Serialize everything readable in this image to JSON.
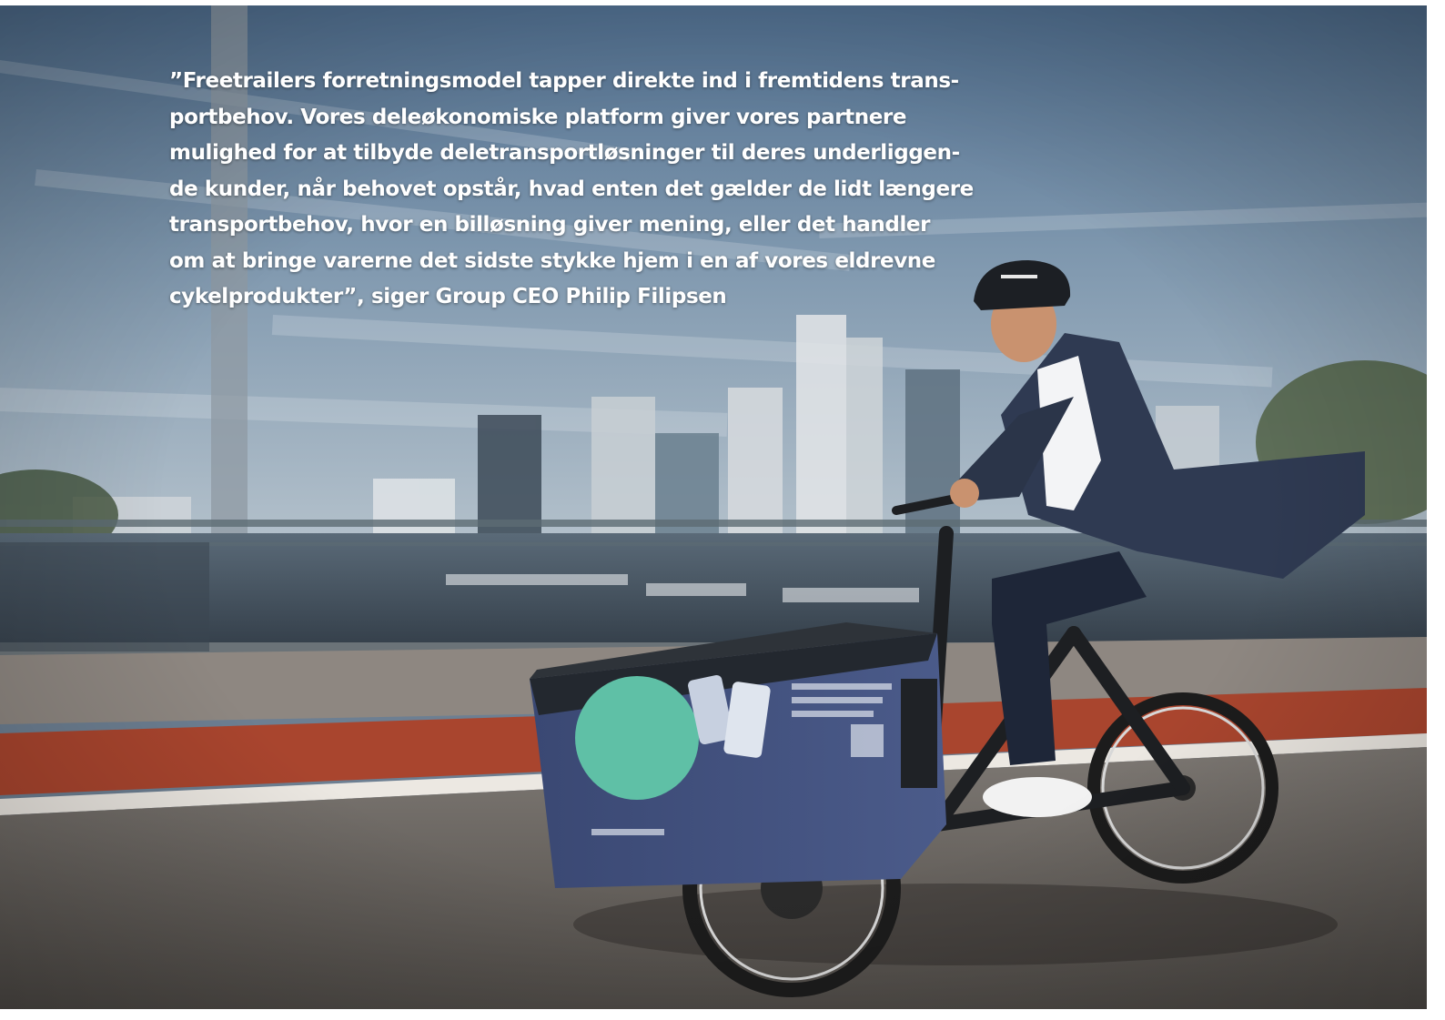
{
  "quote": {
    "lines": [
      "”Freetrailers forretningsmodel tapper direkte ind i fremtidens trans-",
      "portbehov. Vores deleøkonomiske platform giver vores partnere",
      "mulighed for at tilbyde deletransportløsninger til deres underliggen-",
      "de kunder, når behovet opstår, hvad enten det gælder de lidt længere",
      "transportbehov, hvor en billøsning giver mening, eller det handler",
      "om at bringe varerne det sidste stykke hjem i en af vores eldrevne",
      "cykelprodukter”, siger Group CEO Philip Filipsen"
    ]
  },
  "photo": {
    "subject": "man-riding-electric-cargo-bike",
    "colors": {
      "sky": "#6f8aa3",
      "water": "#3e4f60",
      "bike_lane": "#a9452e",
      "road": "#6a6560",
      "cargo_box": "#3f4f7a",
      "cargo_circle": "#5fc0a6"
    }
  }
}
